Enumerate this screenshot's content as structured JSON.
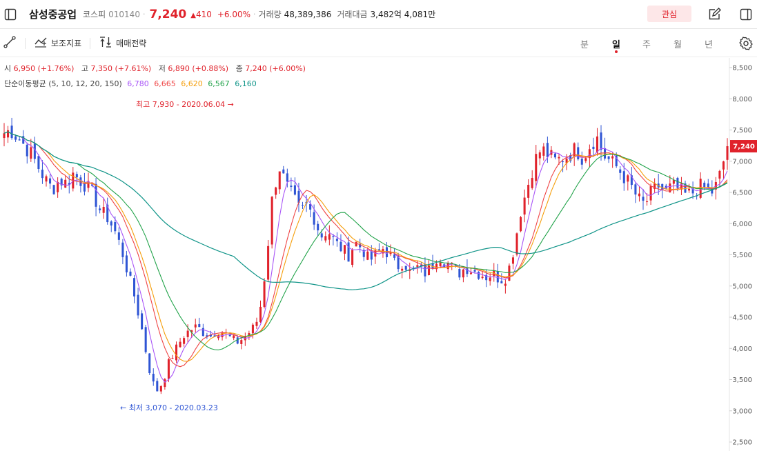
{
  "header": {
    "stock_name": "삼성중공업",
    "market": "코스피",
    "code": "010140",
    "price": "7,240",
    "change": "410",
    "change_pct": "+6.00%",
    "volume_label": "거래량",
    "volume": "48,389,386",
    "trade_value_label": "거래대금",
    "trade_value": "3,482억 4,081만",
    "watch_label": "관심"
  },
  "toolbar": {
    "indicator_label": "보조지표",
    "strategy_label": "매매전략",
    "periods": [
      "분",
      "일",
      "주",
      "월",
      "년"
    ],
    "active_period": "일"
  },
  "ohlc": {
    "open_label": "시",
    "open": "6,950 (+1.76%)",
    "high_label": "고",
    "high": "7,350 (+7.61%)",
    "low_label": "저",
    "low": "6,890 (+0.88%)",
    "close_label": "종",
    "close": "7,240 (+6.00%)"
  },
  "ma_legend": {
    "label": "단순이동평균 (5, 10, 12, 20, 150)",
    "values": [
      {
        "value": "6,780",
        "color": "#a855f7"
      },
      {
        "value": "6,665",
        "color": "#ef4444"
      },
      {
        "value": "6,620",
        "color": "#f59e0b"
      },
      {
        "value": "6,567",
        "color": "#22a34a"
      },
      {
        "value": "6,160",
        "color": "#0f9488"
      }
    ]
  },
  "chart_data": {
    "type": "candlestick",
    "y_ticks": [
      "8,500",
      "8,000",
      "7,500",
      "7,000",
      "6,500",
      "6,000",
      "5,500",
      "5,000",
      "4,500",
      "4,000",
      "3,500",
      "3,000",
      "2,500"
    ],
    "ylim": [
      2500,
      8500
    ],
    "current_price_label": "7,240",
    "high_annotation": "최고 7,930 - 2020.06.04 →",
    "low_annotation": "← 최저 3,070 - 2020.03.23",
    "up_color": "#e0222b",
    "down_color": "#2f55d4",
    "close_path": [
      7450,
      7500,
      7380,
      7250,
      7100,
      6900,
      6700,
      6550,
      6700,
      6650,
      6800,
      6700,
      6600,
      6450,
      6200,
      6100,
      5900,
      5600,
      5200,
      4800,
      4300,
      3700,
      3300,
      3450,
      3800,
      4000,
      4200,
      4300,
      4350,
      4250,
      4200,
      4300,
      4250,
      4150,
      4100,
      4200,
      4300,
      4500,
      5300,
      6500,
      6900,
      6600,
      6400,
      6200,
      6300,
      6100,
      5800,
      5900,
      5700,
      5600,
      5500,
      5700,
      5600,
      5400,
      5500,
      5600,
      5500,
      5300,
      5400,
      5200,
      5300,
      5200,
      5300,
      5500,
      5400,
      5300,
      5200,
      5300,
      5250,
      5200,
      5150,
      5200,
      5100,
      5150,
      5600,
      6200,
      6600,
      7000,
      7200,
      7100,
      7000,
      7050,
      7100,
      7200,
      7050,
      7250,
      7400,
      7100,
      7000,
      6900,
      6750,
      6600,
      6400,
      6300,
      6500,
      6600,
      6500,
      6600,
      6550,
      6450,
      6500,
      6600,
      6550,
      6500,
      6800,
      7240
    ]
  }
}
